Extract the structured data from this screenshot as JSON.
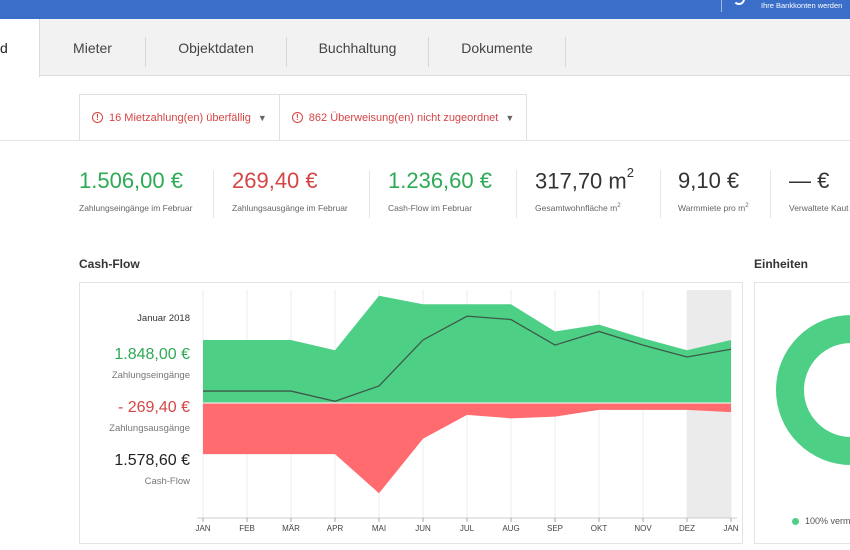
{
  "header": {
    "sync_message": "Ihre Bankkonten werden"
  },
  "tabs": [
    {
      "label": "d",
      "active": true
    },
    {
      "label": "Mieter"
    },
    {
      "label": "Objektdaten"
    },
    {
      "label": "Buchhaltung"
    },
    {
      "label": "Dokumente"
    }
  ],
  "alerts": [
    {
      "text": "16 Mietzahlung(en) überfällig"
    },
    {
      "text": "862 Überweisung(en) nicht zugeordnet"
    }
  ],
  "kpis": [
    {
      "value": "1.506,00 €",
      "label": "Zahlungseingänge im Februar",
      "color": "#2daa55"
    },
    {
      "value": "269,40 €",
      "label": "Zahlungsausgänge im Februar",
      "color": "#d64545"
    },
    {
      "value": "1.236,60 €",
      "label": "Cash-Flow im Februar",
      "color": "#2daa55"
    },
    {
      "value": "317,70 m",
      "value_sup": "2",
      "label": "Gesamtwohnfläche m",
      "label_sup": "2"
    },
    {
      "value": "9,10 €",
      "label": "Warmmiete pro m",
      "label_sup": "2"
    },
    {
      "value": "— €",
      "label": "Verwaltete Kaut"
    }
  ],
  "cashflow": {
    "title": "Cash-Flow",
    "selected_month": "Januar 2018",
    "income_value": "1.848,00 €",
    "income_label": "Zahlungseingänge",
    "expense_value": "- 269,40 €",
    "expense_label": "Zahlungsausgänge",
    "cashflow_value": "1.578,60 €",
    "cashflow_label": "Cash-Flow"
  },
  "units": {
    "title": "Einheiten",
    "legend": "100% verm"
  },
  "colors": {
    "income": "#4ecf86",
    "expense": "#ff6b6e",
    "line": "#3c5a48",
    "accent": "#3b6ec9"
  },
  "chart_data": {
    "type": "area",
    "categories": [
      "JAN",
      "FEB",
      "MÄR",
      "APR",
      "MAI",
      "JUN",
      "JUL",
      "AUG",
      "SEP",
      "OKT",
      "NOV",
      "DEZ",
      "JAN"
    ],
    "series": [
      {
        "name": "Zahlungseingänge",
        "values": [
          1850,
          1850,
          1850,
          1550,
          3150,
          2900,
          2900,
          2900,
          2100,
          2300,
          1900,
          1550,
          1848
        ]
      },
      {
        "name": "Zahlungsausgänge",
        "values": [
          -1500,
          -1500,
          -1500,
          -1500,
          -2650,
          -1050,
          -350,
          -450,
          -400,
          -200,
          -200,
          -200,
          -269.4
        ]
      },
      {
        "name": "Cash-Flow",
        "values": [
          350,
          350,
          350,
          50,
          500,
          1850,
          2550,
          2450,
          1700,
          2100,
          1700,
          1350,
          1578.6
        ]
      }
    ],
    "ylim": [
      -3000,
      3500
    ],
    "highlighted_category_index": 11,
    "grid": true
  }
}
